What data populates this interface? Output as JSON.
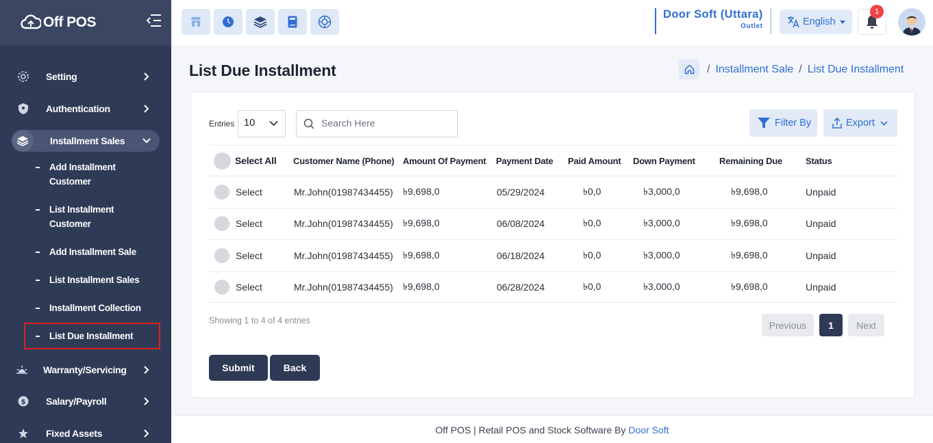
{
  "app": {
    "name": "Off POS"
  },
  "sidebar": {
    "items": [
      {
        "label": "Setting",
        "icon": "gear-icon"
      },
      {
        "label": "Authentication",
        "icon": "shield-icon"
      },
      {
        "label": "Installment Sales",
        "icon": "layers-icon",
        "active": true
      },
      {
        "label": "Warranty/Servicing",
        "icon": "sun-icon"
      },
      {
        "label": "Salary/Payroll",
        "icon": "coin-icon"
      },
      {
        "label": "Fixed Assets",
        "icon": "star-icon"
      }
    ],
    "subitems": [
      {
        "label": "Add Installment Customer"
      },
      {
        "label": "List Installment Customer"
      },
      {
        "label": "Add Installment Sale"
      },
      {
        "label": "List Installment Sales"
      },
      {
        "label": "Installment Collection"
      },
      {
        "label": "List Due Installment",
        "selected": true
      }
    ]
  },
  "topbar": {
    "shortcuts": [
      "store-icon",
      "clock-icon",
      "layers-icon",
      "calculator-icon",
      "target-icon"
    ],
    "outlet_name": "Door Soft (Uttara)",
    "outlet_label": "Outlet",
    "language": "English",
    "notification_count": "1"
  },
  "page": {
    "title": "List Due Installment",
    "breadcrumb": {
      "parent": "Installment Sale",
      "current": "List Due Installment"
    }
  },
  "controls": {
    "entries_label": "Entries",
    "entries_value": "10",
    "search_placeholder": "Search Here",
    "filter_label": "Filter By",
    "export_label": "Export"
  },
  "table": {
    "select_all_label": "Select All",
    "columns": [
      "Customer Name (Phone)",
      "Amount Of Payment",
      "Payment Date",
      "Paid Amount",
      "Down Payment",
      "Remaining Due",
      "Status"
    ],
    "rows": [
      {
        "select": "Select",
        "customer": "Mr.John(01987434455)",
        "amount": "৳9,698,0",
        "date": "05/29/2024",
        "paid": "৳0,0",
        "down": "৳3,000,0",
        "remaining": "৳9,698,0",
        "status": "Unpaid"
      },
      {
        "select": "Select",
        "customer": "Mr.John(01987434455)",
        "amount": "৳9,698,0",
        "date": "06/08/2024",
        "paid": "৳0,0",
        "down": "৳3,000,0",
        "remaining": "৳9,698,0",
        "status": "Unpaid"
      },
      {
        "select": "Select",
        "customer": "Mr.John(01987434455)",
        "amount": "৳9,698,0",
        "date": "06/18/2024",
        "paid": "৳0,0",
        "down": "৳3,000,0",
        "remaining": "৳9,698,0",
        "status": "Unpaid"
      },
      {
        "select": "Select",
        "customer": "Mr.John(01987434455)",
        "amount": "৳9,698,0",
        "date": "06/28/2024",
        "paid": "৳0,0",
        "down": "৳3,000,0",
        "remaining": "৳9,698,0",
        "status": "Unpaid"
      }
    ]
  },
  "pagination": {
    "info": "Showing 1 to 4 of 4 entries",
    "previous": "Previous",
    "current": "1",
    "next": "Next"
  },
  "actions": {
    "submit": "Submit",
    "back": "Back"
  },
  "footer": {
    "text": "Off POS | Retail POS and Stock Software By ",
    "link": "Door Soft"
  },
  "colors": {
    "sidebar": "#2f3a56",
    "accent": "#2f6fd1",
    "badge": "#ef4444"
  }
}
